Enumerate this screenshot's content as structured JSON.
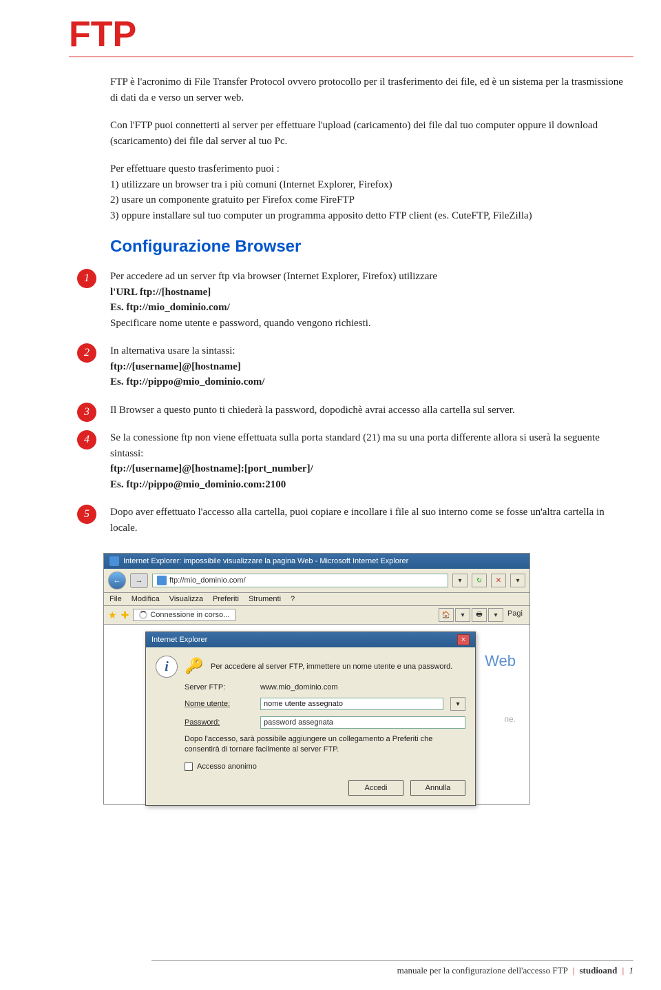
{
  "title": "FTP",
  "intro_p1": "FTP è l'acronimo di File Transfer Protocol ovvero protocollo per il trasferimento dei file, ed è un sistema per la trasmissione di dati da e verso un server web.",
  "intro_p2": "Con l'FTP puoi connetterti al server per effettuare l'upload (caricamento) dei file dal tuo computer oppure il download (scaricamento) dei file dal server al tuo Pc.",
  "intro_p3": "Per effettuare questo trasferimento puoi :\n1) utilizzare un browser tra i più comuni (Internet Explorer, Firefox)\n2) usare un componente gratuito per Firefox come FireFTP\n3) oppure installare sul tuo computer un programma apposito detto FTP client (es. CuteFTP, FileZilla)",
  "section_heading": "Configurazione Browser",
  "steps": {
    "s1": {
      "num": "1",
      "line1": "Per accedere ad un server ftp via browser (Internet Explorer, Firefox) utilizzare",
      "line2": "l'URL ftp://[hostname]",
      "line3": "Es. ftp://mio_dominio.com/",
      "line4": "Specificare nome utente e password, quando vengono richiesti."
    },
    "s2": {
      "num": "2",
      "line1": "In alternativa usare la sintassi:",
      "line2": "ftp://[username]@[hostname]",
      "line3": "Es. ftp://pippo@mio_dominio.com/"
    },
    "s3": {
      "num": "3",
      "line1": "Il Browser a questo punto ti chiederà la password, dopodichè avrai accesso alla cartella sul server."
    },
    "s4": {
      "num": "4",
      "line1": "Se la conessione ftp non viene effettuata sulla porta standard (21) ma su una porta differente allora si userà la seguente sintassi:",
      "line2": "ftp://[username]@[hostname]:[port_number]/",
      "line3": "Es. ftp://pippo@mio_dominio.com:2100"
    },
    "s5": {
      "num": "5",
      "line1": "Dopo aver effettuato l'accesso alla cartella, puoi copiare e incollare i file al suo interno come se fosse un'altra cartella in locale."
    }
  },
  "screenshot": {
    "window_title": "Internet Explorer: impossibile visualizzare la pagina Web - Microsoft Internet Explorer",
    "address": "ftp://mio_dominio.com/",
    "menus": [
      "File",
      "Modifica",
      "Visualizza",
      "Preferiti",
      "Strumenti",
      "?"
    ],
    "connecting": "Connessione in corso...",
    "right_label": "Pagi",
    "web_hint": "Web",
    "gray_text": "ne.",
    "dialog": {
      "title": "Internet Explorer",
      "msg": "Per accedere al server FTP, immettere un nome utente e una password.",
      "server_label": "Server FTP:",
      "server_value": "www.mio_dominio.com",
      "user_label": "Nome utente:",
      "user_value": "nome utente assegnato",
      "pass_label": "Password:",
      "pass_value": "password assegnata",
      "note": "Dopo l'accesso, sarà possibile aggiungere un collegamento a Preferiti che consentirà di tornare facilmente al server FTP.",
      "anon": "Accesso anonimo",
      "ok": "Accedi",
      "cancel": "Annulla"
    }
  },
  "footer": {
    "text": "manuale per la configurazione dell'accesso FTP",
    "brand": "studioand",
    "page": "1"
  }
}
